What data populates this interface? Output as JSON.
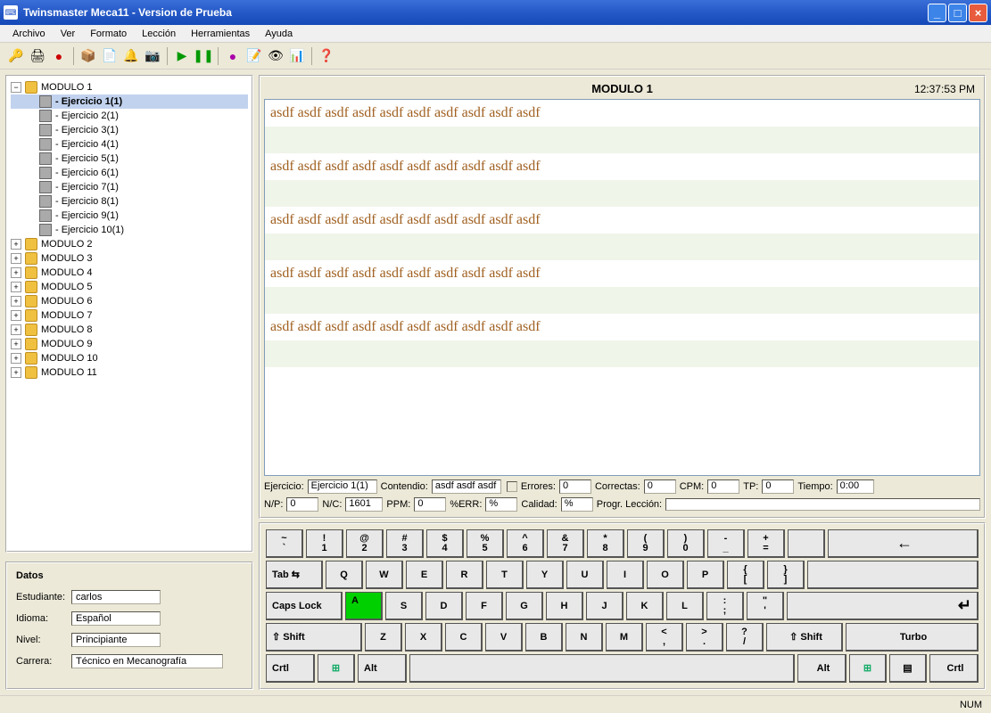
{
  "window": {
    "title": "Twinsmaster Meca11 - Version de Prueba"
  },
  "menu": {
    "items": [
      "Archivo",
      "Ver",
      "Formato",
      "Lección",
      "Herramientas",
      "Ayuda"
    ]
  },
  "tree": {
    "module1": {
      "label": "MODULO 1",
      "exercises": [
        "- Ejercicio 1(1)",
        "- Ejercicio 2(1)",
        "- Ejercicio 3(1)",
        "- Ejercicio 4(1)",
        "- Ejercicio 5(1)",
        "- Ejercicio 6(1)",
        "- Ejercicio 7(1)",
        "- Ejercicio 8(1)",
        "- Ejercicio 9(1)",
        "- Ejercicio 10(1)"
      ]
    },
    "others": [
      "MODULO 2",
      "MODULO 3",
      "MODULO 4",
      "MODULO 5",
      "MODULO 6",
      "MODULO 7",
      "MODULO 8",
      "MODULO 9",
      "MODULO 10",
      "MODULO 11"
    ]
  },
  "datos": {
    "title": "Datos",
    "estudiante_label": "Estudiante:",
    "estudiante_value": "carlos",
    "idioma_label": "Idioma:",
    "idioma_value": "Español",
    "nivel_label": "Nivel:",
    "nivel_value": "Principiante",
    "carrera_label": "Carrera:",
    "carrera_value": "Técnico en Mecanografía"
  },
  "exercise": {
    "header_title": "MODULO 1",
    "clock": "12:37:53 PM",
    "lines": [
      "asdf asdf asdf asdf asdf asdf asdf asdf asdf asdf",
      "",
      "asdf asdf asdf asdf asdf asdf asdf asdf asdf asdf",
      "",
      "asdf asdf asdf asdf asdf asdf asdf asdf asdf asdf",
      "",
      "asdf asdf asdf asdf asdf asdf asdf asdf asdf asdf",
      "",
      "asdf asdf asdf asdf asdf asdf asdf asdf asdf asdf",
      ""
    ]
  },
  "stats1": {
    "ejercicio_l": "Ejercicio:",
    "ejercicio_v": "Ejercicio 1(1)",
    "contenido_l": "Contendio:",
    "contenido_v": "asdf asdf asdf",
    "errores_l": "Errores:",
    "errores_v": "0",
    "correctas_l": "Correctas:",
    "correctas_v": "0",
    "cpm_l": "CPM:",
    "cpm_v": "0",
    "tp_l": "TP:",
    "tp_v": "0",
    "tiempo_l": "Tiempo:",
    "tiempo_v": "0:00"
  },
  "stats2": {
    "np_l": "N/P:",
    "np_v": "0",
    "nc_l": "N/C:",
    "nc_v": "1601",
    "ppm_l": "PPM:",
    "ppm_v": "0",
    "err_l": "%ERR:",
    "err_v": "%",
    "calidad_l": "Calidad:",
    "calidad_v": "%",
    "prog_l": "Progr. Lección:"
  },
  "keys": {
    "tilde_t": "~",
    "tilde_b": "`",
    "n1_t": "!",
    "n1_b": "1",
    "n2_t": "@",
    "n2_b": "2",
    "n3_t": "#",
    "n3_b": "3",
    "n4_t": "$",
    "n4_b": "4",
    "n5_t": "%",
    "n5_b": "5",
    "n6_t": "^",
    "n6_b": "6",
    "n7_t": "&",
    "n7_b": "7",
    "n8_t": "*",
    "n8_b": "8",
    "n9_t": "(",
    "n9_b": "9",
    "n0_t": ")",
    "n0_b": "0",
    "minus_t": "-",
    "minus_b": "_",
    "plus_t": "+",
    "plus_b": "=",
    "back": "←",
    "tab": "Tab ⇆",
    "q": "Q",
    "w": "W",
    "e": "E",
    "r": "R",
    "t": "T",
    "y": "Y",
    "u": "U",
    "i": "I",
    "o": "O",
    "p": "P",
    "lb_t": "{",
    "lb_b": "[",
    "rb_t": "}",
    "rb_b": "]",
    "caps": "Caps Lock",
    "a": "A",
    "s": "S",
    "d": "D",
    "f": "F",
    "g": "G",
    "h": "H",
    "j": "J",
    "k": "K",
    "l": "L",
    "semi_t": ":",
    "semi_b": ";",
    "quote_t": "\"",
    "quote_b": "'",
    "enter": "↵",
    "lshift": "⇧ Shift",
    "z": "Z",
    "x": "X",
    "c": "C",
    "v": "V",
    "b": "B",
    "n": "N",
    "m": "M",
    "comma_t": "<",
    "comma_b": ",",
    "period_t": ">",
    "period_b": ".",
    "slash_t": "?",
    "slash_b": "/",
    "rshift": "⇧ Shift",
    "turbo": "Turbo",
    "lctrl": "Crtl",
    "lwin": "⊞",
    "lalt": "Alt",
    "ralt": "Alt",
    "rwin": "⊞",
    "rmenu": "▤",
    "rctrl": "Crtl"
  },
  "status": {
    "num": "NUM"
  }
}
